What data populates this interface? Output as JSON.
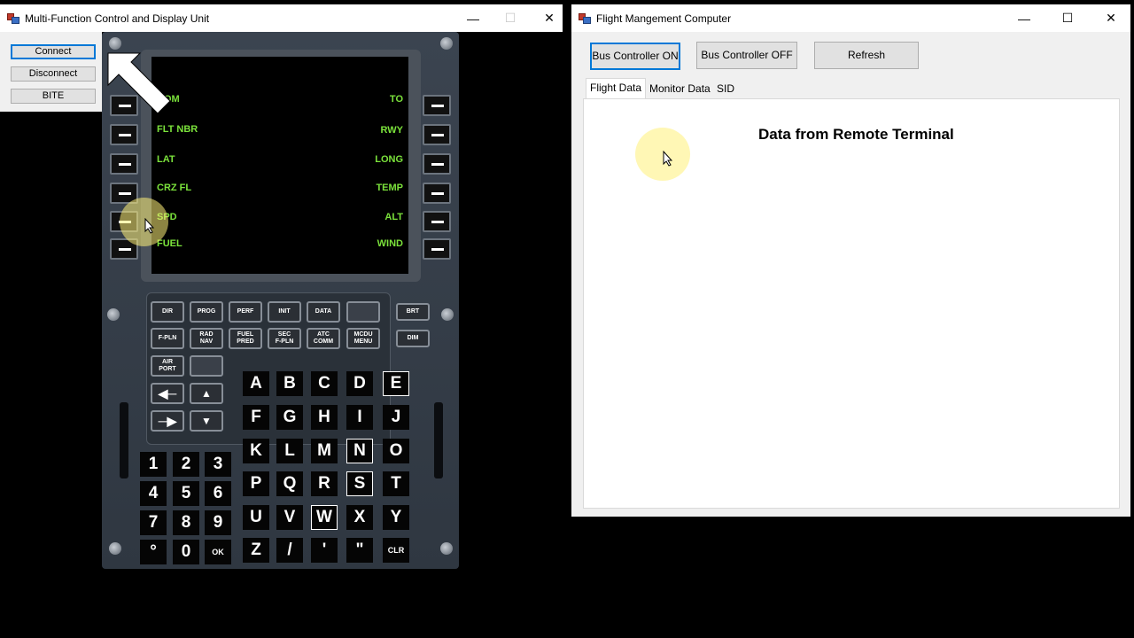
{
  "mcdu_window": {
    "title": "Multi-Function Control and Display Unit",
    "buttons": {
      "connect": "Connect",
      "disconnect": "Disconnect",
      "bite": "BITE"
    },
    "screen": {
      "left_labels": [
        "NOM",
        "FLT NBR",
        "LAT",
        "CRZ FL",
        "SPD",
        "FUEL"
      ],
      "right_labels": [
        "TO",
        "RWY",
        "LONG",
        "TEMP",
        "ALT",
        "WIND"
      ]
    },
    "function_keys": {
      "row1": [
        "DIR",
        "PROG",
        "PERF",
        "INIT",
        "DATA"
      ],
      "row2": [
        "F-PLN",
        "RAD\nNAV",
        "FUEL\nPRED",
        "SEC\nF-PLN",
        "ATC\nCOMM",
        "MCDU\nMENU"
      ],
      "airport": "AIR\nPORT",
      "brt": "BRT",
      "dim": "DIM"
    },
    "letters": [
      "A",
      "B",
      "C",
      "D",
      "E",
      "F",
      "G",
      "H",
      "I",
      "J",
      "K",
      "L",
      "M",
      "N",
      "O",
      "P",
      "Q",
      "R",
      "S",
      "T",
      "U",
      "V",
      "W",
      "X",
      "Y",
      "Z",
      "/",
      "'",
      "\"",
      "CLR"
    ],
    "numbers": [
      "1",
      "2",
      "3",
      "4",
      "5",
      "6",
      "7",
      "8",
      "9",
      "°",
      "0",
      "OK"
    ]
  },
  "fmc_window": {
    "title": "Flight Mangement Computer",
    "buttons": {
      "bus_on": "Bus Controller ON",
      "bus_off": "Bus Controller OFF",
      "refresh": "Refresh"
    },
    "tabs": [
      "Flight Data",
      "Monitor Data",
      "SID"
    ],
    "active_tab": "Flight Data",
    "heading": "Data from Remote Terminal"
  },
  "window_controls": {
    "minimize": "—",
    "maximize": "☐",
    "close": "✕"
  }
}
